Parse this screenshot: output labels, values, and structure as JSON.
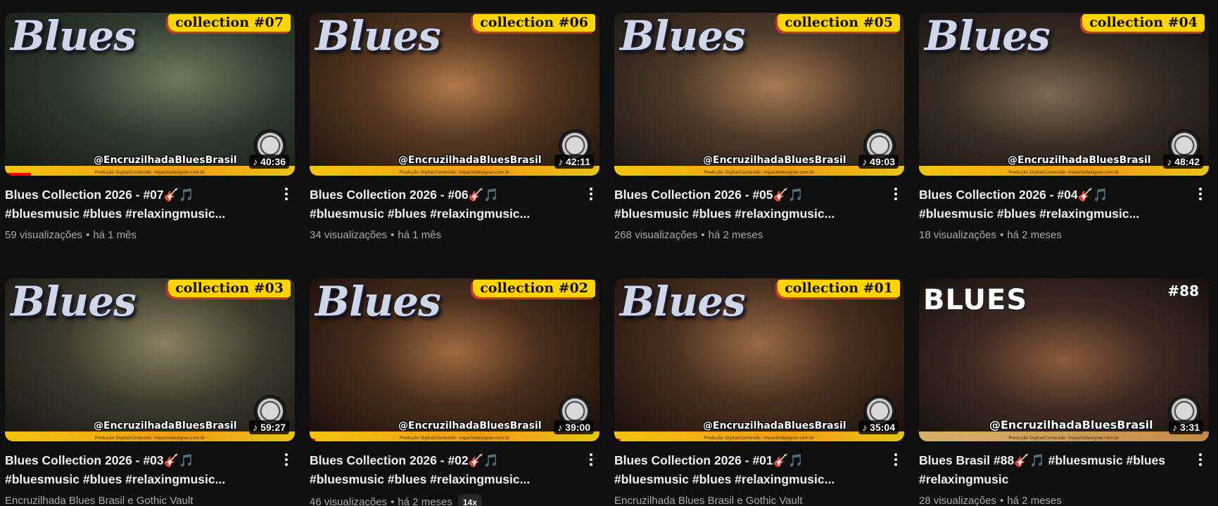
{
  "videos": [
    {
      "title": "Blues Collection 2026 - #07🎸🎵 #bluesmusic #blues #relaxingmusic...",
      "views": "59 visualizações",
      "age": "há 1 mês",
      "duration": "♪ 40:36",
      "logo": "Blues",
      "badge": "collection #07",
      "tag": "@EncruzilhadaBluesBrasil",
      "credit": "Produção Digital/Conteúdo: impactodesigner.com.br",
      "progress": 0.09
    },
    {
      "title": "Blues Collection 2026 - #06🎸🎵 #bluesmusic #blues #relaxingmusic...",
      "views": "34 visualizações",
      "age": "há 1 mês",
      "duration": "♪ 42:11",
      "logo": "Blues",
      "badge": "collection #06",
      "tag": "@EncruzilhadaBluesBrasil",
      "credit": "Produção Digital/Conteúdo: impactodesigner.com.br",
      "progress": 0
    },
    {
      "title": "Blues Collection 2026 - #05🎸🎵 #bluesmusic #blues #relaxingmusic...",
      "views": "268 visualizações",
      "age": "há 2 meses",
      "duration": "♪ 49:03",
      "logo": "Blues",
      "badge": "collection #05",
      "tag": "@EncruzilhadaBluesBrasil",
      "credit": "Produção Digital/Conteúdo: impactodesigner.com.br",
      "progress": 0
    },
    {
      "title": "Blues Collection 2026 - #04🎸🎵 #bluesmusic #blues #relaxingmusic...",
      "views": "18 visualizações",
      "age": "há 2 meses",
      "duration": "♪ 48:42",
      "logo": "Blues",
      "badge": "collection #04",
      "tag": "@EncruzilhadaBluesBrasil",
      "credit": "Produção Digital/Conteúdo: impactodesigner.com.br",
      "progress": 0
    },
    {
      "title": "Blues Collection 2026 - #03🎸🎵 #bluesmusic #blues #relaxingmusic...",
      "views": "Encruzilhada Blues Brasil e Gothic Vault",
      "age": "",
      "duration": "♪ 59:27",
      "logo": "Blues",
      "badge": "collection #03",
      "tag": "@EncruzilhadaBluesBrasil",
      "credit": "Produção Digital/Conteúdo: impactodesigner.com.br",
      "progress": 0
    },
    {
      "title": "Blues Collection 2026 - #02🎸🎵 #bluesmusic #blues #relaxingmusic...",
      "views": "46 visualizações",
      "age": "há 2 meses",
      "chip": "14x",
      "duration": "♪ 39:00",
      "logo": "Blues",
      "badge": "collection #02",
      "tag": "@EncruzilhadaBluesBrasil",
      "credit": "Produção Digital/Conteúdo: impactodesigner.com.br",
      "progress": 0.02
    },
    {
      "title": "Blues Collection 2026 - #01🎸🎵 #bluesmusic #blues #relaxingmusic...",
      "views": "Encruzilhada Blues Brasil e Gothic Vault",
      "age": "",
      "duration": "♪ 35:04",
      "logo": "Blues",
      "badge": "collection #01",
      "tag": "@EncruzilhadaBluesBrasil",
      "credit": "Produção Digital/Conteúdo: impactodesigner.com.br",
      "progress": 0.02
    },
    {
      "title": "Blues Brasil #88🎸🎵 #bluesmusic #blues #relaxingmusic",
      "views": "28 visualizações",
      "age": "há 2 meses",
      "duration": "♪ 3:31",
      "logo": "BLUES",
      "badge": "#88",
      "tag": "@EncruzilhadaBluesBrasil",
      "credit": "Produção Digital/Conteúdo: impactodesigner.com.br",
      "progress": 0
    }
  ],
  "colors": {
    "page_bg": "#0f0f0f",
    "text_primary": "#f1f1f1",
    "text_secondary": "#aaaaaa",
    "progress": "#ff0000",
    "badge_yellow": "#ffd400"
  },
  "icons": {
    "menu": "vertical-ellipsis-icon",
    "duration": "music-note-icon"
  }
}
